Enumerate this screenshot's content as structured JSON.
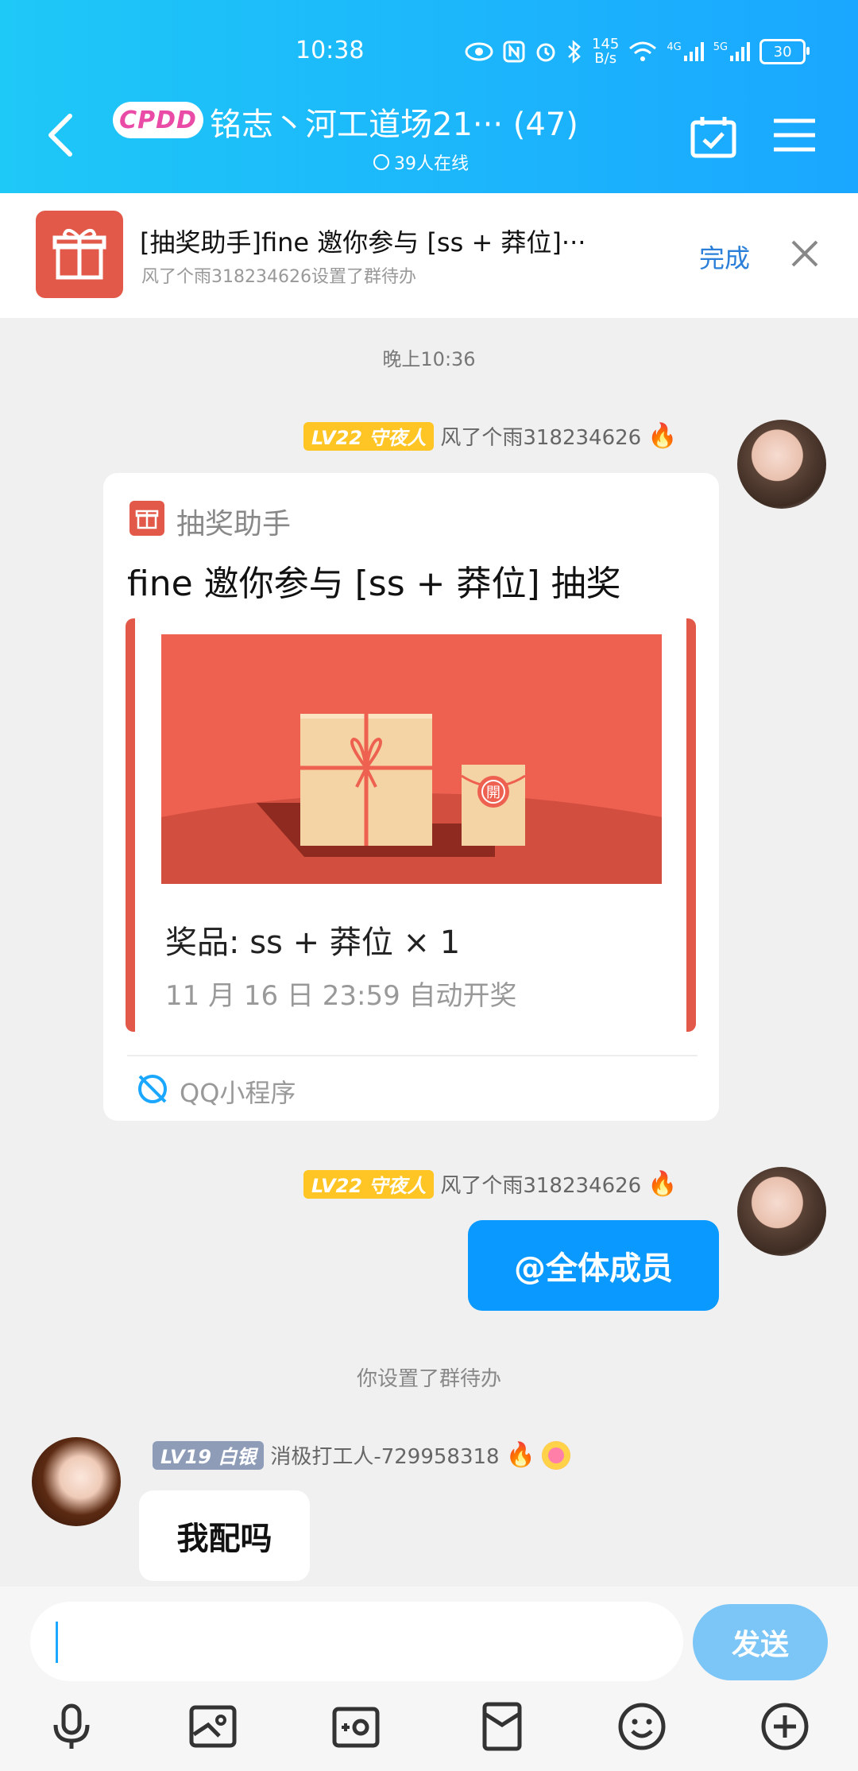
{
  "status_bar": {
    "time": "10:38",
    "net_speed_value": "145",
    "net_speed_unit": "B/s",
    "net_4g": "4G",
    "net_5g": "5G",
    "battery": "30"
  },
  "header": {
    "badge": "CPDD",
    "title": "铭志丶河工道场21··· (47)",
    "online": "39人在线"
  },
  "todo_banner": {
    "title": "[抽奖助手]fine 邀你参与 [ss + 莽位]···",
    "subtitle": "风了个雨318234626设置了群待办",
    "done_label": "完成"
  },
  "messages": {
    "timestamp": "晚上10:36",
    "msg1": {
      "level": "LV22 守夜人",
      "sender": "风了个雨318234626",
      "card": {
        "app_name": "抽奖助手",
        "title": "fine 邀你参与 [ss + 莽位] 抽奖",
        "stamp": "開",
        "prize": "奖品: ss + 莽位  × 1",
        "draw_time": "11 月 16 日 23:59 自动开奖",
        "source": "QQ小程序"
      }
    },
    "msg2": {
      "level": "LV22 守夜人",
      "sender": "风了个雨318234626",
      "text": "@全体成员"
    },
    "system_notice": "你设置了群待办",
    "msg3": {
      "level": "LV19 白银",
      "sender": "消极打工人-729958318",
      "text": "我配吗"
    }
  },
  "input": {
    "value": "",
    "send_label": "发送"
  },
  "toolbar": [
    "microphone-icon",
    "image-icon",
    "camera-icon",
    "red-packet-icon",
    "emoji-icon",
    "plus-icon"
  ],
  "colors": {
    "header_gradient_start": "#1ec8f7",
    "header_gradient_end": "#1aa7ff",
    "bubble_blue": "#0a99ff",
    "lottery_red": "#e25949",
    "level_gold": "#ffc524",
    "level_silver": "#8e9cb8"
  }
}
